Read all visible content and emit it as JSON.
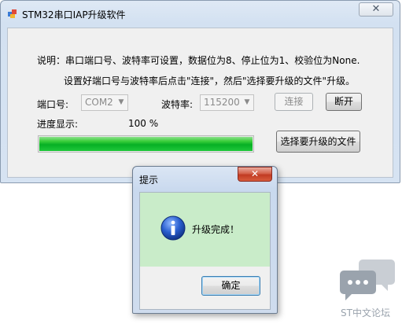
{
  "window": {
    "title": "STM32串口IAP升级软件",
    "close_label": "✕"
  },
  "instructions": {
    "line1": "说明：串口端口号、波特率可设置，数据位为8、停止位为1、校验位为None.",
    "line2": "设置好端口号与波特率后点击\"连接\"，然后\"选择要升级的文件\"升级。"
  },
  "port": {
    "label": "端口号:",
    "value": "COM2"
  },
  "baud": {
    "label": "波特率:",
    "value": "115200"
  },
  "buttons": {
    "connect": "连接",
    "disconnect": "断开",
    "select_file": "选择要升级的文件"
  },
  "progress": {
    "label": "进度显示:",
    "percent_text": "100 %",
    "value": 1.0
  },
  "dialog": {
    "title": "提示",
    "close_label": "✕",
    "message": "升级完成！",
    "ok_label": "确定"
  },
  "watermark": {
    "text": "ST中文论坛"
  },
  "colors": {
    "progress_green": "#06b025",
    "message_bg": "#c9ecc9",
    "title_bar": "#d3e1f1",
    "close_red": "#c13a22"
  }
}
